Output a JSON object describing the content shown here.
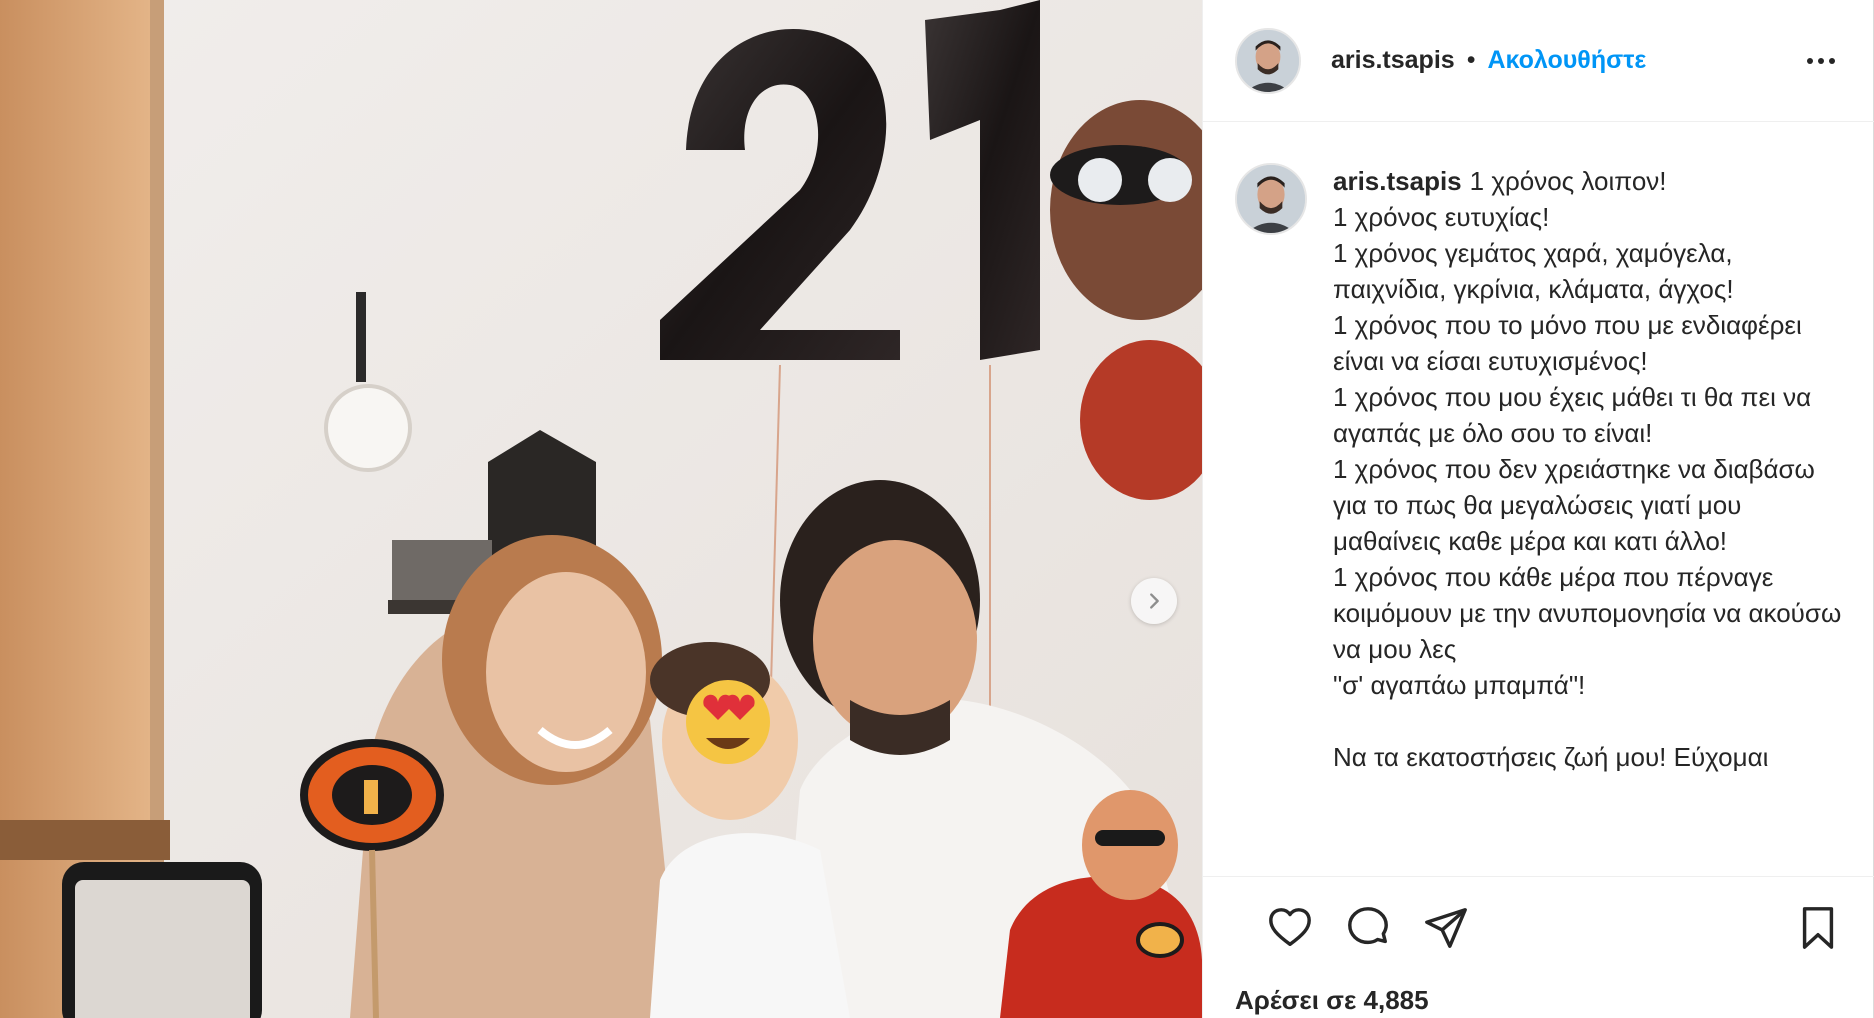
{
  "post": {
    "username": "aris.tsapis",
    "separator": "•",
    "follow_label": "Ακολουθήστε",
    "caption": "1 χρόνος λοιπον!\n1 χρόνος ευτυχίας!\n1 χρόνος γεμάτος χαρά, χαμόγελα, παιχνίδια, γκρίνια, κλάματα, άγχος!\n1 χρόνος που το μόνο που με ενδιαφέρει είναι να είσαι ευτυχισμένος!\n1 χρόνος που μου έχεις μάθει τι θα πει να αγαπάς με όλο σου το είναι!\n1 χρόνος που δεν χρειάστηκε να διαβάσω για το πως θα μεγαλώσεις γιατί μου μαθαίνεις καθε μέρα και κατι άλλο!\n1 χρόνος που κάθε μέρα που πέρναγε κοιμόμουν με την ανυπομονησία να ακούσω να μου λες\n\"σ' αγαπάω μπαμπά\"!\n\nΝα τα εκατοστήσεις ζωή μου! Εύχομαι",
    "likes_text": "Αρέσει σε 4,885"
  },
  "icons": {
    "more": "more-options-icon",
    "next": "chevron-right-icon",
    "like": "heart-icon",
    "comment": "comment-icon",
    "share": "paper-plane-icon",
    "save": "bookmark-icon"
  },
  "colors": {
    "link_blue": "#0095f6",
    "text": "#262626",
    "border": "#efefef"
  }
}
